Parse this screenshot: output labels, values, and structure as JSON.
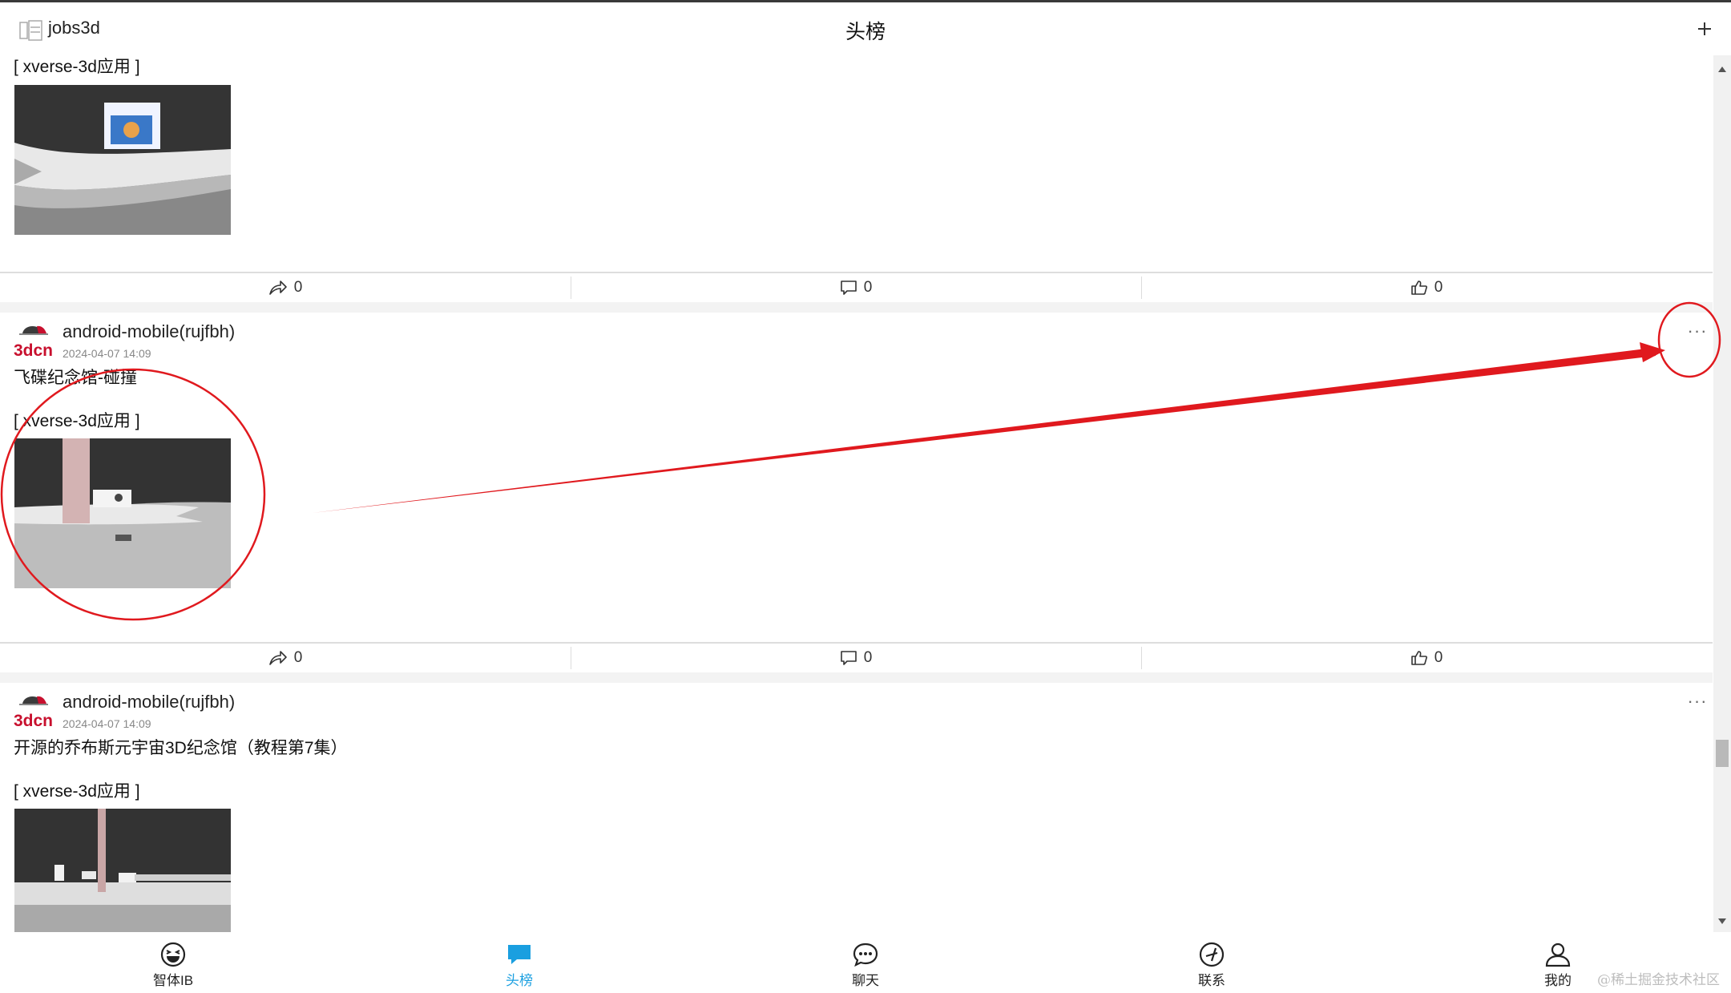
{
  "header": {
    "app_name": "jobs3d",
    "title": "头榜"
  },
  "posts": [
    {
      "tag": "[ xverse-3d应用 ]",
      "actions": {
        "share": "0",
        "comment": "0",
        "like": "0"
      }
    },
    {
      "brand": "3dcn",
      "author": "android-mobile(rujfbh)",
      "time": "2024-04-07 14:09",
      "more": "···",
      "title": "飞碟纪念馆-碰撞",
      "tag": "[ xverse-3d应用 ]",
      "actions": {
        "share": "0",
        "comment": "0",
        "like": "0"
      }
    },
    {
      "brand": "3dcn",
      "author": "android-mobile(rujfbh)",
      "time": "2024-04-07 14:09",
      "more": "···",
      "title": "开源的乔布斯元宇宙3D纪念馆（教程第7集）",
      "tag": "[ xverse-3d应用 ]"
    }
  ],
  "tabbar": {
    "tabs": [
      {
        "label": "智体IB",
        "icon": "laugh-face-icon",
        "active": false
      },
      {
        "label": "头榜",
        "icon": "chat-bubble-icon",
        "active": true
      },
      {
        "label": "聊天",
        "icon": "speech-bubble-icon",
        "active": false
      },
      {
        "label": "联系",
        "icon": "compass-icon",
        "active": false
      },
      {
        "label": "我的",
        "icon": "person-icon",
        "active": false
      }
    ]
  },
  "watermark": "@稀土掘金技术社区",
  "colors": {
    "accent": "#1a9fe0",
    "annotation_red": "#e0191e",
    "brand_red": "#c8102e"
  }
}
